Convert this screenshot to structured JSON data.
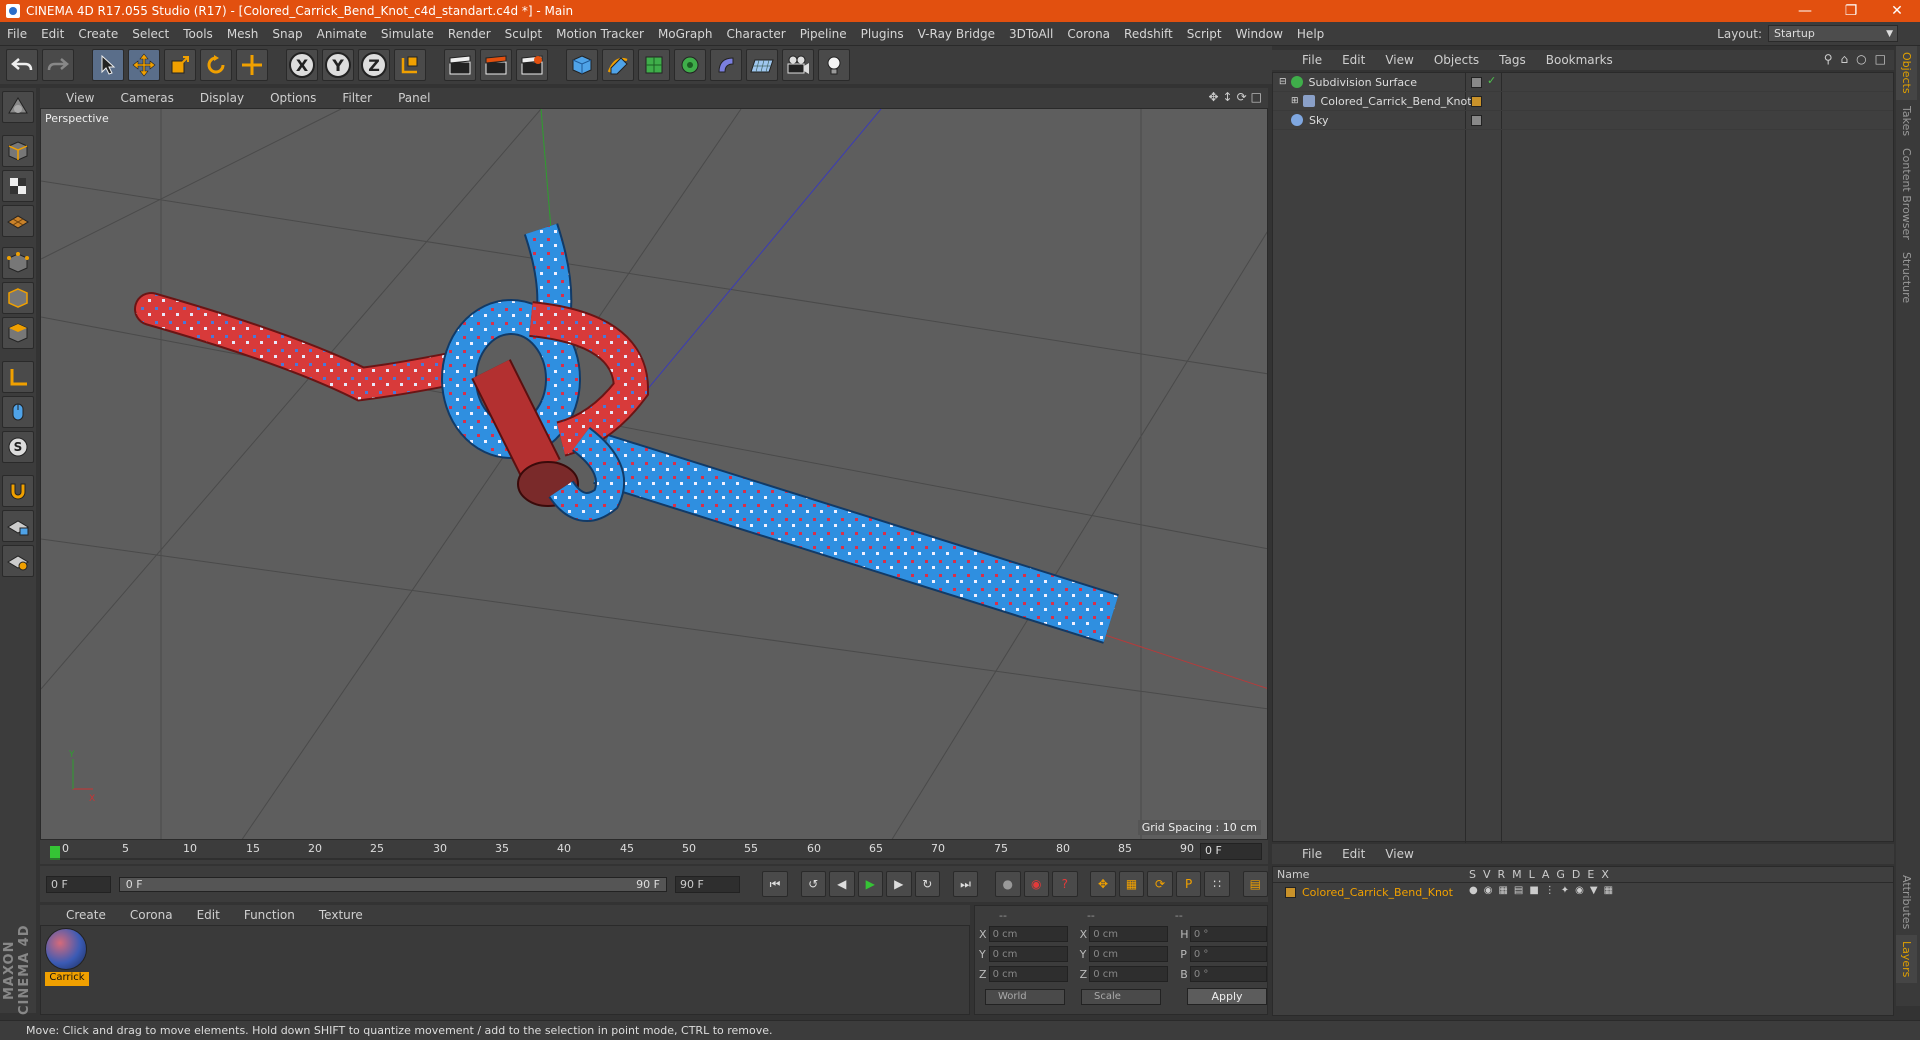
{
  "window": {
    "title": "CINEMA 4D R17.055 Studio (R17) - [Colored_Carrick_Bend_Knot_c4d_standart.c4d *] - Main",
    "controls": [
      "minimize",
      "restore",
      "close"
    ]
  },
  "menubar": {
    "items": [
      "File",
      "Edit",
      "Create",
      "Select",
      "Tools",
      "Mesh",
      "Snap",
      "Animate",
      "Simulate",
      "Render",
      "Sculpt",
      "Motion Tracker",
      "MoGraph",
      "Character",
      "Pipeline",
      "Plugins",
      "V-Ray Bridge",
      "3DToAll",
      "Corona",
      "Redshift",
      "Script",
      "Window",
      "Help"
    ],
    "layout_label": "Layout:",
    "layout_value": "Startup"
  },
  "toolbar": {
    "axis_x": "X",
    "axis_y": "Y",
    "axis_z": "Z"
  },
  "viewport": {
    "menu": [
      "View",
      "Cameras",
      "Display",
      "Options",
      "Filter",
      "Panel"
    ],
    "label": "Perspective",
    "grid_spacing": "Grid Spacing : 10 cm"
  },
  "timeline": {
    "ticks": [
      "0",
      "5",
      "10",
      "15",
      "20",
      "25",
      "30",
      "35",
      "40",
      "45",
      "50",
      "55",
      "60",
      "65",
      "70",
      "75",
      "80",
      "85",
      "90"
    ],
    "current_frame": "0 F",
    "start_field": "0 F",
    "slider_start": "0 F",
    "slider_end": "90 F",
    "end_field": "90 F"
  },
  "material_manager": {
    "menu": [
      "Create",
      "Corona",
      "Edit",
      "Function",
      "Texture"
    ],
    "material_name": "Carrick"
  },
  "coordinates": {
    "header": [
      "--",
      "--",
      "--"
    ],
    "rows": [
      {
        "a": "X",
        "av": "0 cm",
        "b": "X",
        "bv": "0 cm",
        "c": "H",
        "cv": "0 °"
      },
      {
        "a": "Y",
        "av": "0 cm",
        "b": "Y",
        "bv": "0 cm",
        "c": "P",
        "cv": "0 °"
      },
      {
        "a": "Z",
        "av": "0 cm",
        "b": "Z",
        "bv": "0 cm",
        "c": "B",
        "cv": "0 °"
      }
    ],
    "space": "World",
    "mode": "Scale",
    "apply_label": "Apply"
  },
  "object_manager": {
    "menu": [
      "File",
      "Edit",
      "View",
      "Objects",
      "Tags",
      "Bookmarks"
    ],
    "objects": [
      {
        "name": "Subdivision Surface",
        "icon_color": "#3fae4a"
      },
      {
        "name": "Colored_Carrick_Bend_Knot",
        "icon_color": "#8aa0c8"
      },
      {
        "name": "Sky",
        "icon_color": "#7fa7e0"
      }
    ]
  },
  "right_tabs": [
    "Objects",
    "Takes",
    "Content Browser",
    "Structure",
    "Attributes",
    "Layers"
  ],
  "layer_manager": {
    "menu": [
      "File",
      "Edit",
      "View"
    ],
    "name_header": "Name",
    "columns": [
      "S",
      "V",
      "R",
      "M",
      "L",
      "A",
      "G",
      "D",
      "E",
      "X"
    ],
    "layer_name": "Colored_Carrick_Bend_Knot"
  },
  "branding": "MAXON CINEMA 4D",
  "status": "Move: Click and drag to move elements. Hold down SHIFT to quantize movement / add to the selection in point mode, CTRL to remove.",
  "colors": {
    "title_bar": "#e2500f",
    "accent_orange": "#f0a000",
    "rope_red": "#d83a3a",
    "rope_blue": "#2f8fe0"
  }
}
